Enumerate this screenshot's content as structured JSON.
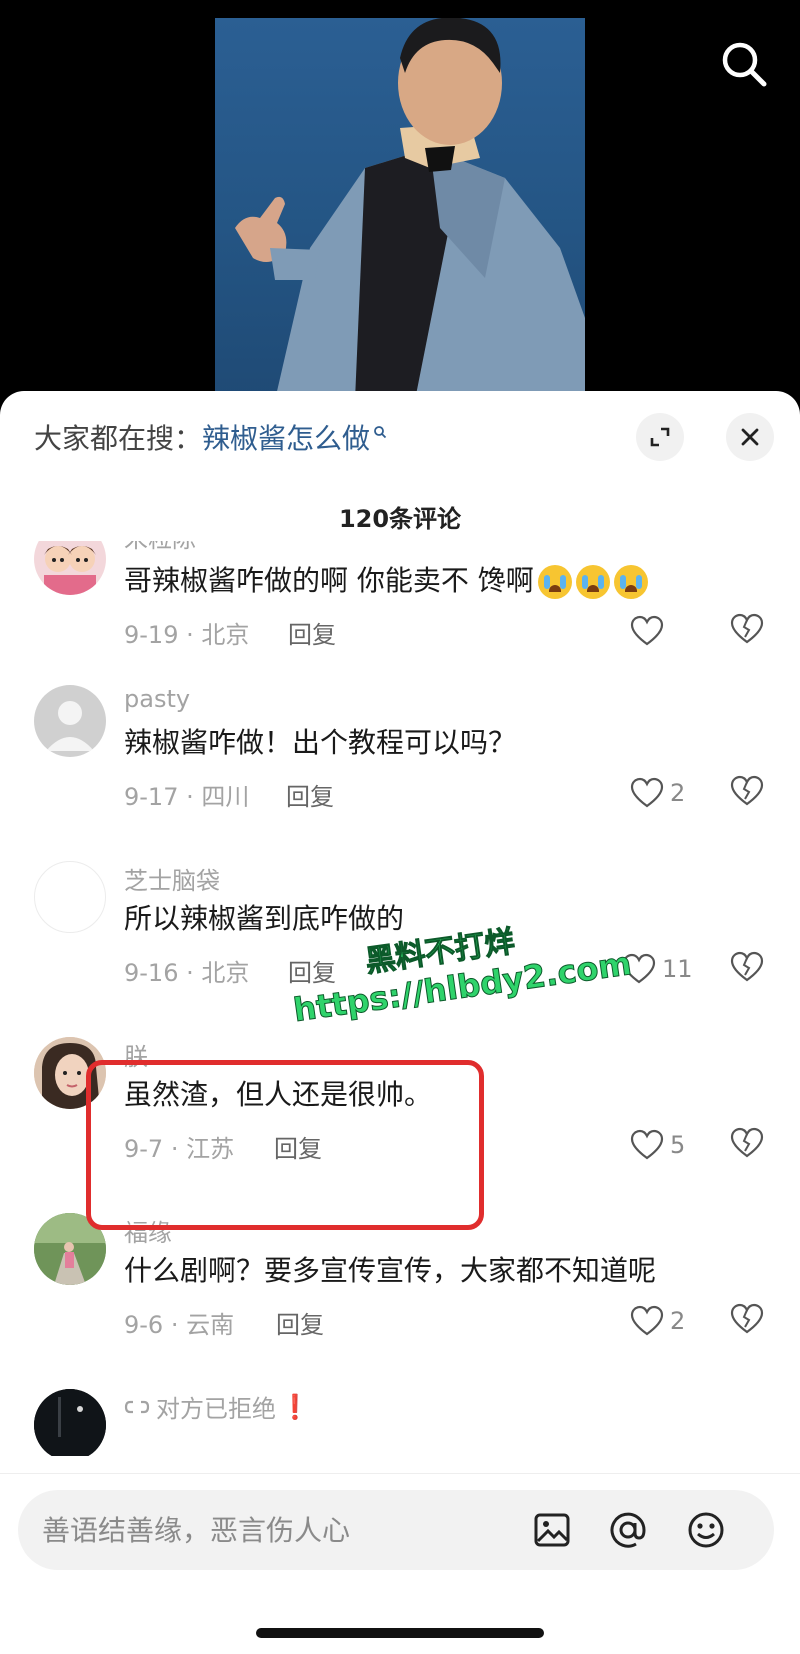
{
  "hot_search": {
    "prefix": "大家都在搜：",
    "query": "辣椒酱怎么做"
  },
  "comment_count": "120条评论",
  "comments": [
    {
      "name": "宋粒陈",
      "text": "哥辣椒酱咋做的啊 你能卖不 馋啊",
      "emoji": "loudly-crying-face",
      "date_location": "9-19 · 北京",
      "reply": "回复",
      "likes": ""
    },
    {
      "name": "pasty",
      "text": "辣椒酱咋做！出个教程可以吗？",
      "date_location": "9-17 · 四川",
      "reply": "回复",
      "likes": "2"
    },
    {
      "name": "芝士脑袋",
      "text": "所以辣椒酱到底咋做的",
      "date_location": "9-16 · 北京",
      "reply": "回复",
      "likes": "11"
    },
    {
      "name": "朕",
      "text": "虽然渣，但人还是很帅。",
      "date_location": "9-7 · 江苏",
      "reply": "回复",
      "likes": "5"
    },
    {
      "name": "福缘",
      "text": "什么剧啊？要多宣传宣传，大家都不知道呢",
      "date_location": "9-6 · 云南",
      "reply": "回复",
      "likes": "2"
    },
    {
      "name": "对方已拒绝",
      "name_prefix_icon": "link-icon",
      "name_suffix": "❗"
    }
  ],
  "watermark": {
    "line1": "黑料不打烊",
    "line2": "https://hlbdy2.com"
  },
  "input": {
    "placeholder": "善语结善缘，恶言伤人心"
  },
  "icons": [
    "search-icon",
    "expand-icon",
    "close-icon",
    "heart-icon",
    "broken-heart-icon",
    "image-icon",
    "at-icon",
    "emoji-icon"
  ],
  "colors": {
    "highlight_border": "#e02d2d",
    "link": "#2f5d8f",
    "watermark": "#2fd36b"
  }
}
